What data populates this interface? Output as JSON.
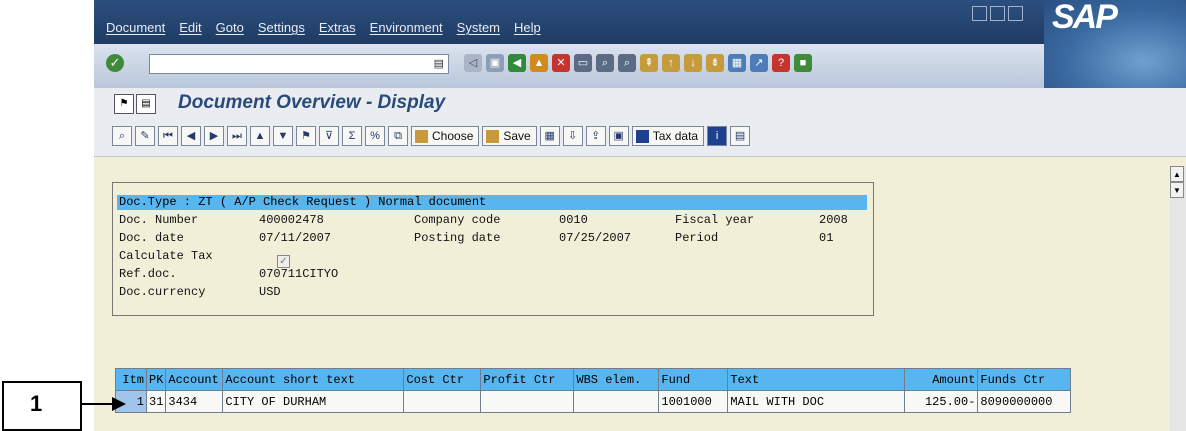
{
  "menubar": {
    "items": [
      "Document",
      "Edit",
      "Goto",
      "Settings",
      "Extras",
      "Environment",
      "System",
      "Help"
    ],
    "logo": "SAP"
  },
  "title": "Document Overview - Display",
  "toolbar": {
    "choose_label": "Choose",
    "save_label": "Save",
    "taxdata_label": "Tax data"
  },
  "header": {
    "doc_type_line": "Doc.Type : ZT ( A/P Check Request ) Normal document",
    "doc_number_label": "Doc. Number",
    "doc_number": "400002478",
    "company_code_label": "Company code",
    "company_code": "0010",
    "fiscal_year_label": "Fiscal year",
    "fiscal_year": "2008",
    "doc_date_label": "Doc. date",
    "doc_date": "07/11/2007",
    "posting_date_label": "Posting date",
    "posting_date": "07/25/2007",
    "period_label": "Period",
    "period": "01",
    "calc_tax_label": "Calculate Tax",
    "calc_tax_checked": true,
    "refdoc_label": "Ref.doc.",
    "refdoc": "070711CITYO",
    "currency_label": "Doc.currency",
    "currency": "USD"
  },
  "table": {
    "columns": [
      "Itm",
      "PK",
      "Account",
      "Account short text",
      "Cost Ctr",
      "Profit Ctr",
      "WBS elem.",
      "Fund",
      "Text",
      "Amount",
      "Funds Ctr"
    ],
    "rows": [
      {
        "itm": "1",
        "pk": "31",
        "account": "3434",
        "short_text": "CITY OF DURHAM",
        "cost_ctr": "",
        "profit_ctr": "",
        "wbs": "",
        "fund": "1001000",
        "text": "MAIL WITH DOC",
        "amount": "125.00-",
        "funds_ctr": "8090000000"
      }
    ]
  },
  "callout": {
    "number": "1"
  },
  "colors": {
    "header_blue": "#57b6f0",
    "title_text": "#2a4a7c",
    "background": "#f2efd9"
  }
}
